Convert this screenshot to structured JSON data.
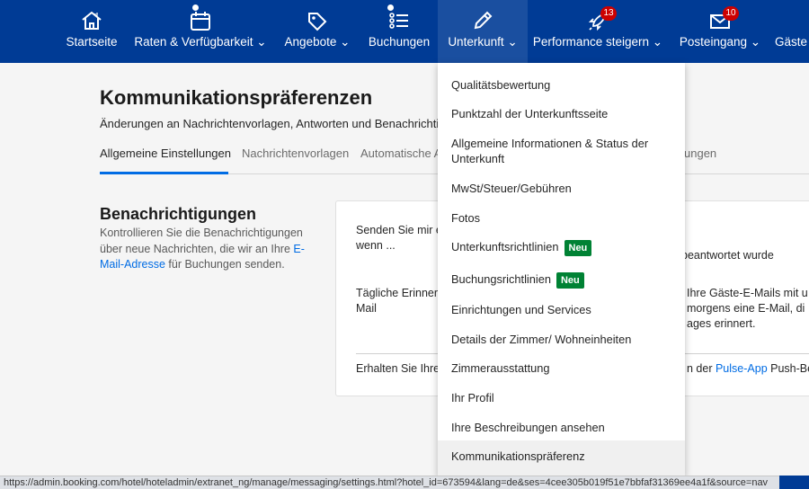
{
  "nav": {
    "items": [
      {
        "label": "Startseite",
        "icon": "home-icon"
      },
      {
        "label": "Raten & Verfügbarkeit",
        "icon": "calendar-icon"
      },
      {
        "label": "Angebote",
        "icon": "tag-icon"
      },
      {
        "label": "Buchungen",
        "icon": "list-icon"
      },
      {
        "label": "Unterkunft",
        "icon": "pencil-icon"
      },
      {
        "label": "Performance steigern",
        "icon": "rocket-icon",
        "badge": "13"
      },
      {
        "label": "Posteingang",
        "icon": "envelope-icon",
        "badge": "10"
      },
      {
        "label": "Gäste",
        "icon": "guests-icon"
      }
    ]
  },
  "page": {
    "title": "Kommunikationspräferenzen",
    "subtitle": "Änderungen an Nachrichtenvorlagen, Antworten und Benachrichtig"
  },
  "tabs": [
    "Allgemeine Einstellungen",
    "Nachrichtenvorlagen",
    "Automatische A",
    "ungen"
  ],
  "section": {
    "title": "Benachrichtigungen",
    "desc_part1": "Kontrollieren Sie die Benachrichtigungen über neue Nachrichten, die wir an Ihre ",
    "desc_link": "E-Mail-Adresse",
    "desc_part2": " für Buchungen senden."
  },
  "card": {
    "row1_left_a": "Senden Sie mir e",
    "row1_left_b": "wenn ...",
    "row1_right": "beantwortet wurde",
    "row2_left_a": "Tägliche Erinner",
    "row2_left_b": "Mail",
    "row2_right_a": "Ihre Gäste-E-Mails mit u",
    "row2_right_b": "morgens eine E-Mail, di",
    "row2_right_c": "ages erinnert.",
    "row3_left": "Erhalten Sie Ihre",
    "row3_right_a": "n der ",
    "row3_right_link": "Pulse-App",
    "row3_right_b": " Push-Be"
  },
  "dropdown": {
    "items": [
      {
        "label": "Qualitätsbewertung"
      },
      {
        "label": "Punktzahl der Unterkunftsseite"
      },
      {
        "label": "Allgemeine Informationen & Status der Unterkunft"
      },
      {
        "label": "MwSt/Steuer/Gebühren"
      },
      {
        "label": "Fotos"
      },
      {
        "label": "Unterkunftsrichtlinien",
        "badge": "Neu"
      },
      {
        "label": "Buchungsrichtlinien",
        "badge": "Neu"
      },
      {
        "label": "Einrichtungen und Services"
      },
      {
        "label": "Details der Zimmer/ Wohneinheiten"
      },
      {
        "label": "Zimmerausstattung"
      },
      {
        "label": "Ihr Profil"
      },
      {
        "label": "Ihre Beschreibungen ansehen"
      },
      {
        "label": "Kommunikationspräferenz"
      }
    ]
  },
  "statusbar": {
    "url": "https://admin.booking.com/hotel/hoteladmin/extranet_ng/manage/messaging/settings.html?hotel_id=673594&lang=de&ses=4cee305b019f51e7bbfaf31369ee4a1f&source=nav"
  },
  "colors": {
    "nav_bg": "#003b95",
    "accent": "#006ce4",
    "new_badge": "#008234",
    "notif_badge": "#cc0000"
  }
}
